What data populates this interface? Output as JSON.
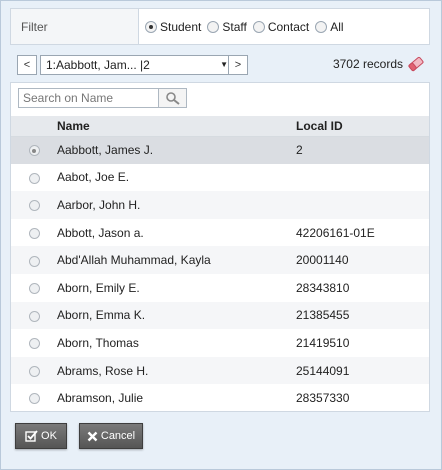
{
  "filter": {
    "label": "Filter",
    "options": [
      {
        "label": "Student",
        "checked": true
      },
      {
        "label": "Staff",
        "checked": false
      },
      {
        "label": "Contact",
        "checked": false
      },
      {
        "label": "All",
        "checked": false
      }
    ]
  },
  "nav": {
    "prev": "<",
    "next": ">",
    "selected": "1:Aabbott, Jam... |2",
    "records": "3702 records"
  },
  "search": {
    "placeholder": "Search on Name"
  },
  "table": {
    "headers": [
      "Name",
      "Local ID"
    ],
    "rows": [
      {
        "name": "Aabbott, James J.",
        "id": "2",
        "selected": true
      },
      {
        "name": "Aabot, Joe E.",
        "id": ""
      },
      {
        "name": "Aarbor, John H.",
        "id": ""
      },
      {
        "name": "Abbott, Jason a.",
        "id": "42206161-01E"
      },
      {
        "name": "Abd'Allah Muhammad, Kayla",
        "id": "20001140"
      },
      {
        "name": "Aborn, Emily E.",
        "id": "28343810"
      },
      {
        "name": "Aborn, Emma K.",
        "id": "21385455"
      },
      {
        "name": "Aborn, Thomas",
        "id": "21419510"
      },
      {
        "name": "Abrams, Rose H.",
        "id": "25144091"
      },
      {
        "name": "Abramson, Julie",
        "id": "28357330"
      }
    ]
  },
  "buttons": {
    "ok": "OK",
    "cancel": "Cancel"
  },
  "colors": {
    "background": "#e8f0f8",
    "button": "#666666",
    "eraser": "#e06070"
  }
}
